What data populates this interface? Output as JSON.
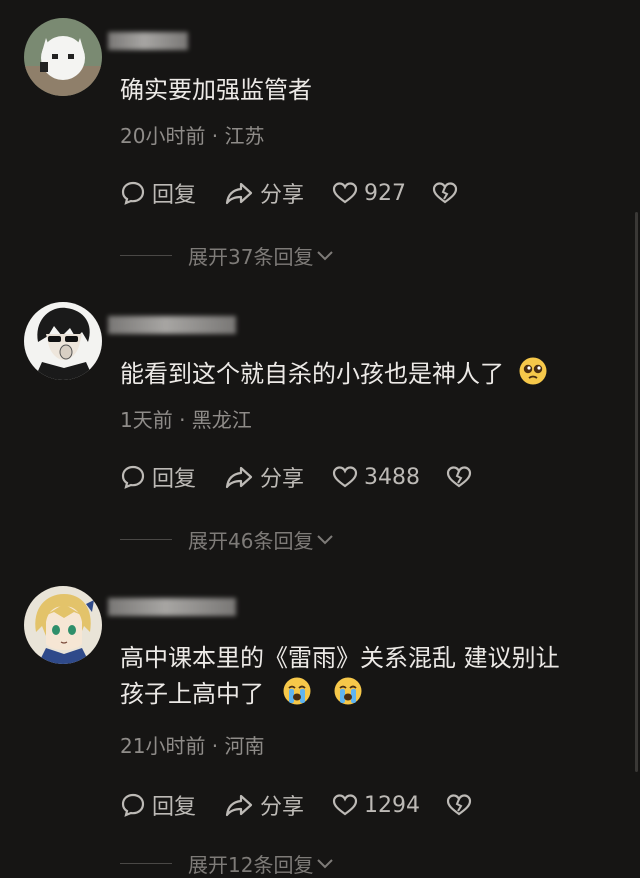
{
  "labels": {
    "reply": "回复",
    "share": "分享"
  },
  "comments": [
    {
      "text_line1": "确实要加强监管者",
      "text_line2": "",
      "meta": "20小时前 · 江苏",
      "likes": "927",
      "expand": "展开37条回复"
    },
    {
      "text_line1": "能看到这个就自杀的小孩也是神人了",
      "text_line2": "",
      "meta": "1天前 · 黑龙江",
      "likes": "3488",
      "expand": "展开46条回复"
    },
    {
      "text_line1": "高中课本里的《雷雨》关系混乱  建议别让",
      "text_line2": "孩子上高中了",
      "meta": "21小时前 · 河南",
      "likes": "1294",
      "expand": "展开12条回复"
    }
  ],
  "emoji": [
    "pleading-face",
    "loudly-crying-face",
    "loudly-crying-face"
  ]
}
